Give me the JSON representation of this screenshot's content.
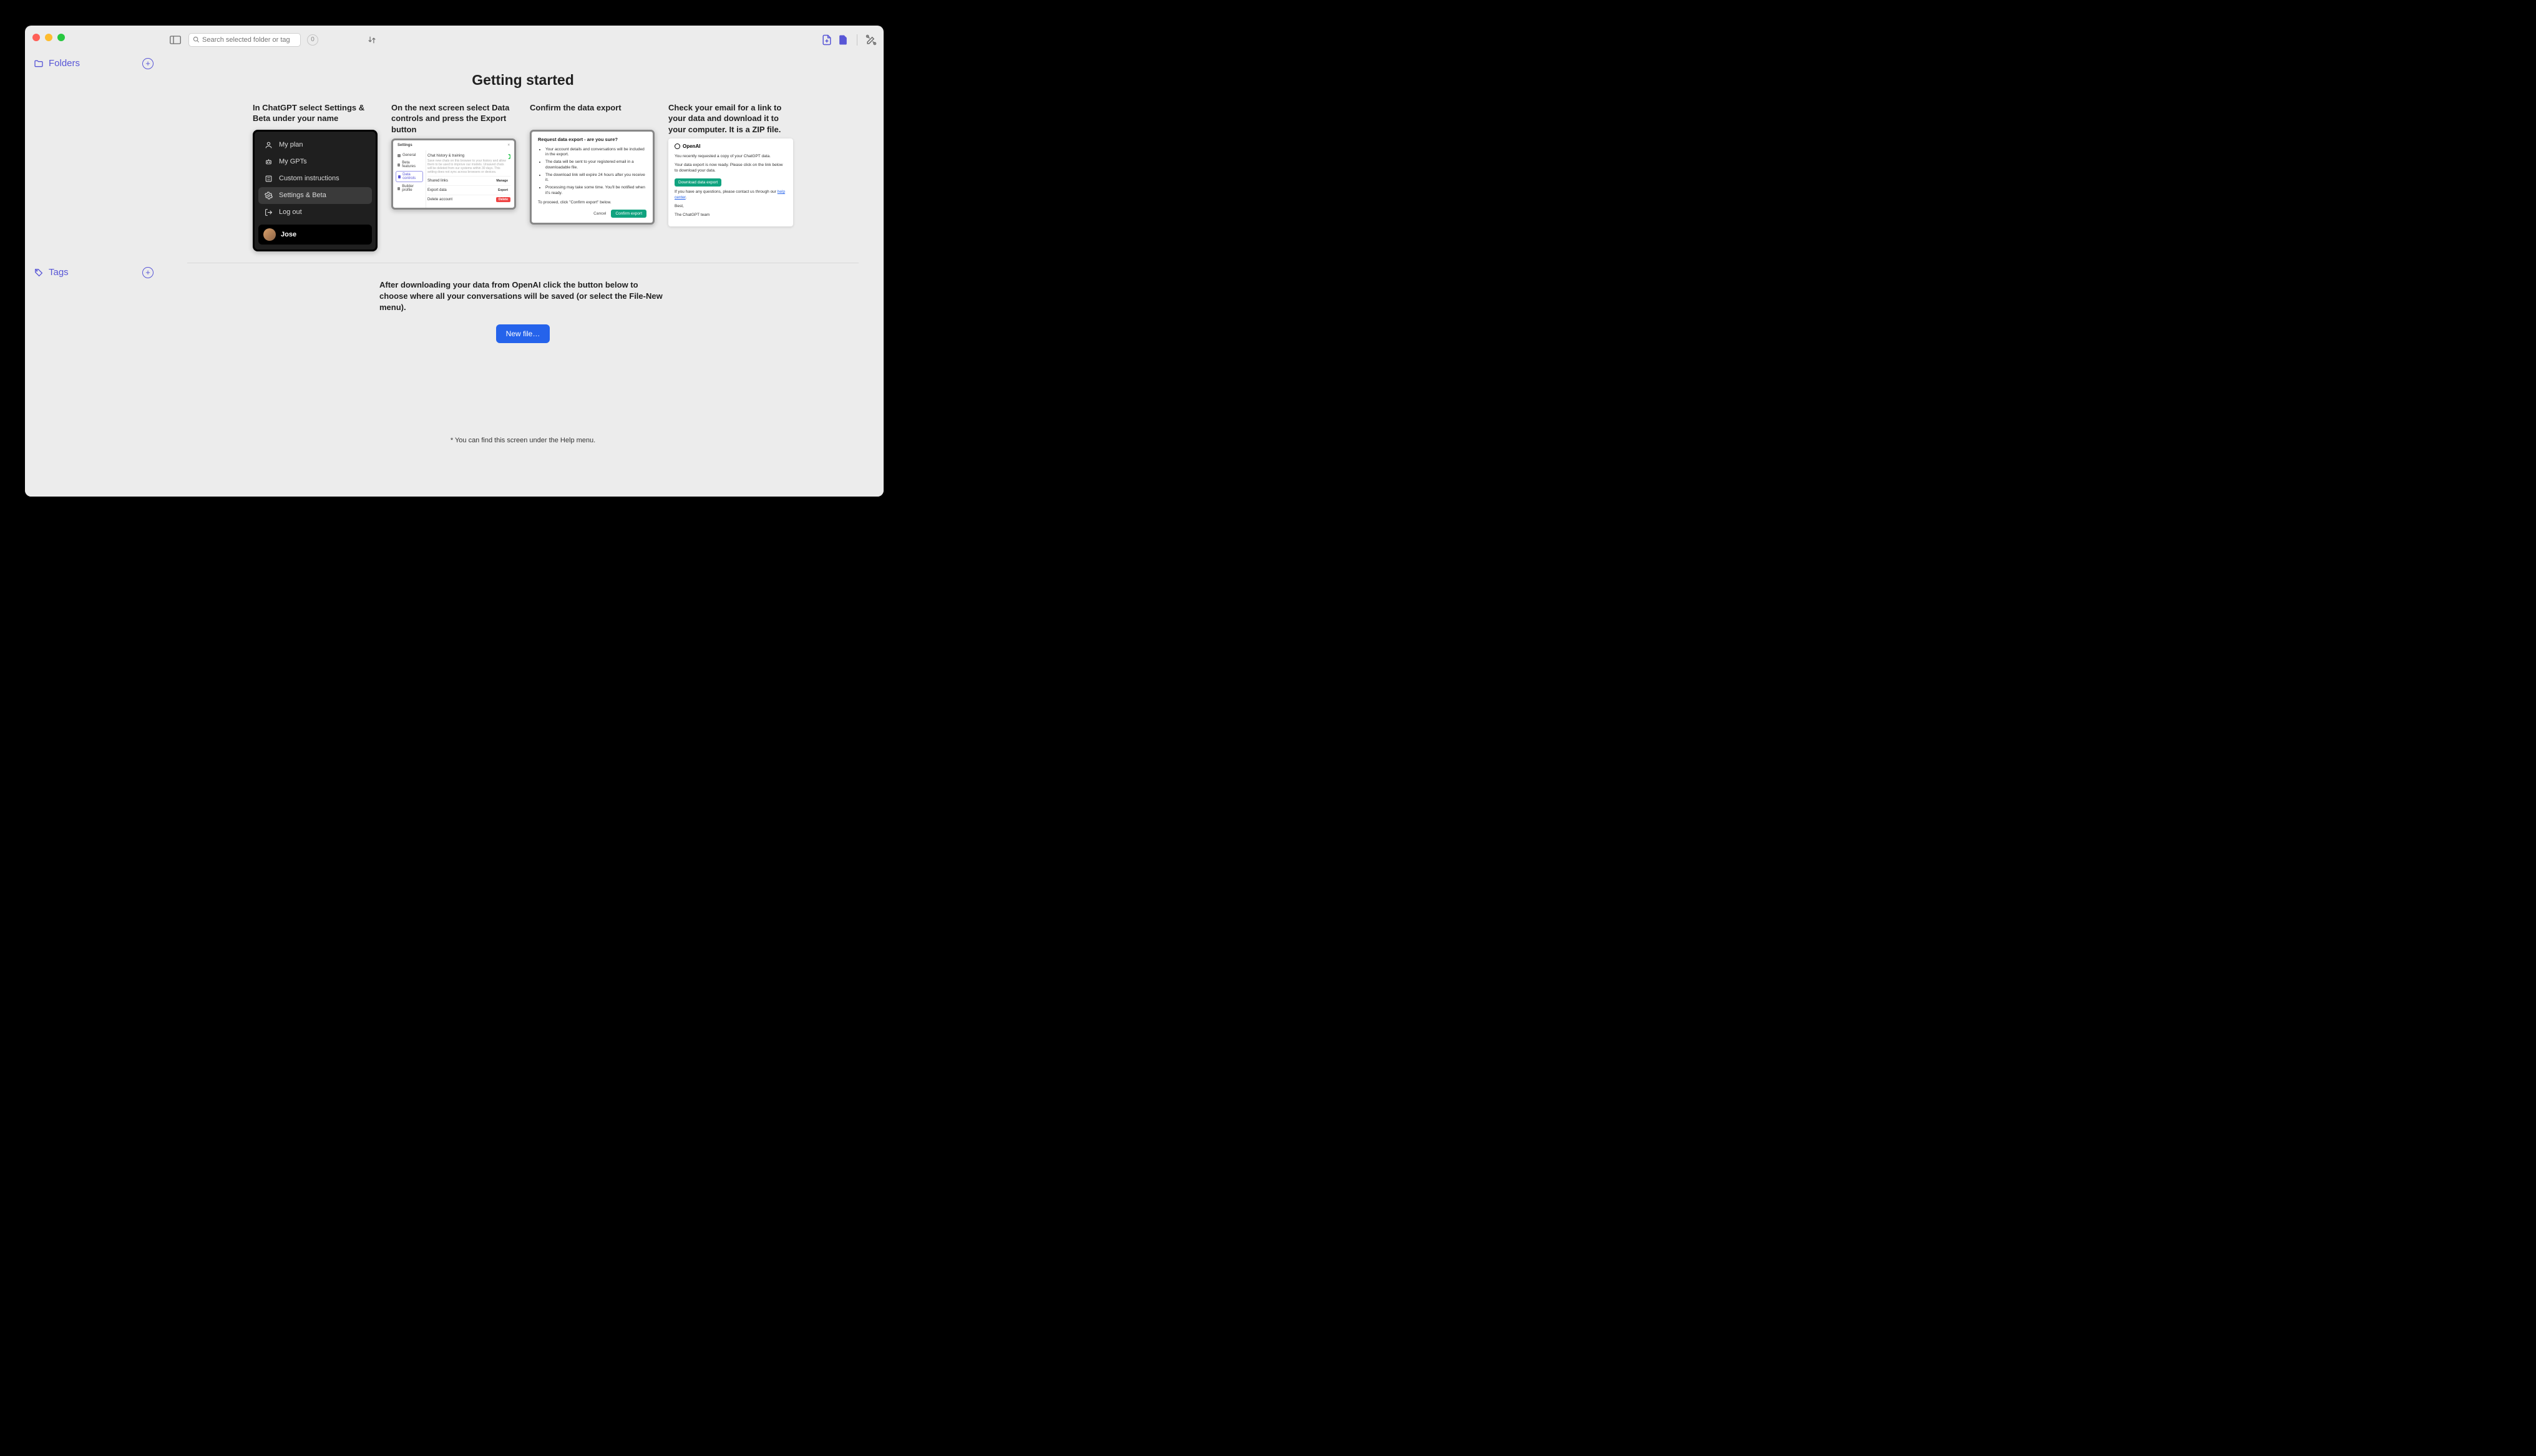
{
  "sidebar": {
    "folders_label": "Folders",
    "tags_label": "Tags"
  },
  "toolbar": {
    "search_placeholder": "Search selected folder or tag",
    "badge_count": "0"
  },
  "page": {
    "title": "Getting started",
    "after_text": "After downloading your data from OpenAI click the button below to choose where all your conversations will be saved (or select the File-New menu).",
    "new_file_label": "New file…",
    "footnote": "* You can find this screen under the Help menu."
  },
  "steps": [
    {
      "title": "In ChatGPT select Settings & Beta under your name",
      "menu": {
        "items": [
          "My plan",
          "My GPTs",
          "Custom instructions",
          "Settings & Beta",
          "Log out"
        ],
        "highlighted_index": 3,
        "user": "Jose"
      }
    },
    {
      "title": "On the next screen select Data controls and press the Export button",
      "settings": {
        "header": "Settings",
        "nav": [
          "General",
          "Beta features",
          "Data controls",
          "Builder profile"
        ],
        "selected_nav_index": 2,
        "rows": {
          "history_label": "Chat history & training",
          "shared_label": "Shared links",
          "shared_action": "Manage",
          "export_label": "Export data",
          "export_action": "Export",
          "delete_label": "Delete account",
          "delete_action": "Delete"
        }
      }
    },
    {
      "title": "Confirm the data export",
      "confirm": {
        "heading": "Request data export - are you sure?",
        "bullets": [
          "Your account details and conversations will be included in the export.",
          "The data will be sent to your registered email in a downloadable file.",
          "The download link will expire 24 hours after you receive it.",
          "Processing may take some time. You'll be notified when it's ready."
        ],
        "proceed": "To proceed, click \"Confirm export\" below.",
        "cancel": "Cancel",
        "confirm_btn": "Confirm export"
      }
    },
    {
      "title": "Check your email for a link to your data and download it to your computer. It is a ZIP file.",
      "email": {
        "brand": "OpenAI",
        "line1": "You recently requested a copy of your ChatGPT data.",
        "line2": "Your data export is now ready. Please click on the link below to download your data.",
        "button": "Download data export",
        "line3_pre": "If you have any questions, please contact us through our ",
        "line3_link": "help center",
        "signoff1": "Best,",
        "signoff2": "The ChatGPT team"
      }
    }
  ]
}
